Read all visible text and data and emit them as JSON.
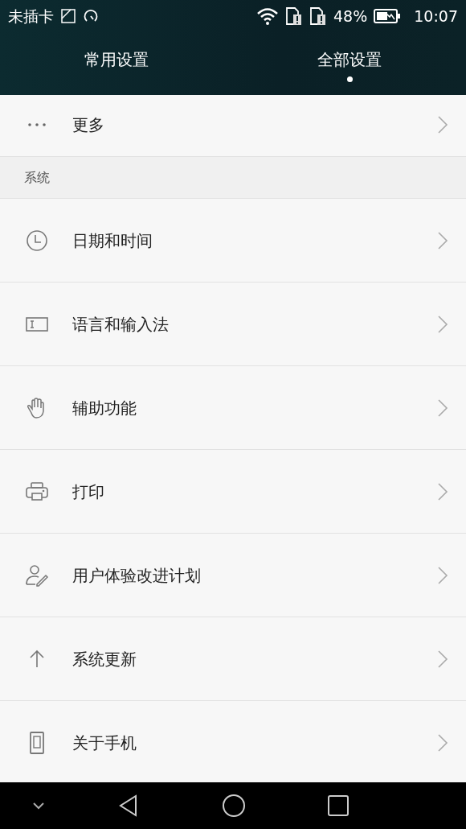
{
  "status_bar": {
    "carrier": "未插卡",
    "battery": "48%",
    "time": "10:07"
  },
  "tabs": [
    {
      "label": "常用设置",
      "selected": false
    },
    {
      "label": "全部设置",
      "selected": true
    }
  ],
  "list": [
    {
      "kind": "row",
      "label": "更多"
    },
    {
      "kind": "header",
      "label": "系统"
    },
    {
      "kind": "row",
      "label": "日期和时间"
    },
    {
      "kind": "row",
      "label": "语言和输入法"
    },
    {
      "kind": "row",
      "label": "辅助功能"
    },
    {
      "kind": "row",
      "label": "打印"
    },
    {
      "kind": "row",
      "label": "用户体验改进计划"
    },
    {
      "kind": "row",
      "label": "系统更新"
    },
    {
      "kind": "row",
      "label": "关于手机"
    }
  ]
}
